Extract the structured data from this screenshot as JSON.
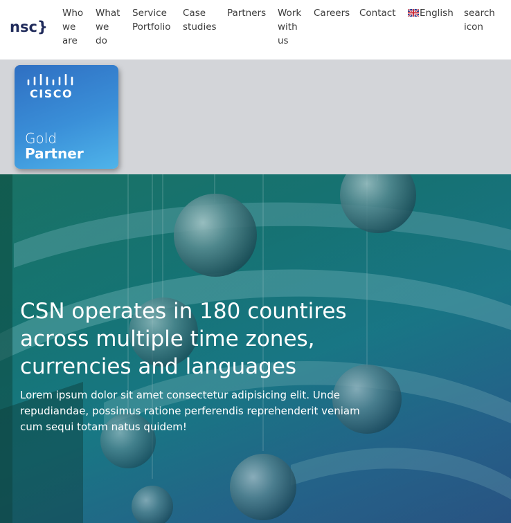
{
  "header": {
    "logo_text": "nsc}",
    "nav": [
      {
        "id": "who-we-are",
        "lines": [
          "Who",
          "we",
          "are"
        ]
      },
      {
        "id": "what-we-do",
        "lines": [
          "What",
          "we",
          "do"
        ]
      },
      {
        "id": "service-portfolio",
        "lines": [
          "Service",
          "Portfolio"
        ]
      },
      {
        "id": "case-studies",
        "lines": [
          "Case",
          "studies"
        ]
      },
      {
        "id": "partners",
        "lines": [
          "Partners"
        ]
      },
      {
        "id": "work-with-us",
        "lines": [
          "Work",
          "with",
          "us"
        ]
      },
      {
        "id": "careers",
        "lines": [
          "Careers"
        ]
      },
      {
        "id": "contact",
        "lines": [
          "Contact"
        ]
      }
    ],
    "language": "English",
    "search_label_lines": [
      "search",
      "icon"
    ]
  },
  "partner_badge": {
    "brand": "CISCO",
    "tier": "Gold",
    "level": "Partner"
  },
  "hero": {
    "title": "CSN operates in 180 countires across multiple time zones, currencies and languages",
    "body": "Lorem ipsum dolor sit amet consectetur adipisicing elit. Unde repudiandae, possimus ratione perferendis reprehenderit veniam cum sequi totam natus quidem!"
  },
  "colors": {
    "logo": "#1f2a5a",
    "nav_text": "#3b3b3b",
    "partner_band": "#d3d5d9",
    "badge_blue": "#3a8fd8",
    "hero_teal": "#17807f"
  }
}
